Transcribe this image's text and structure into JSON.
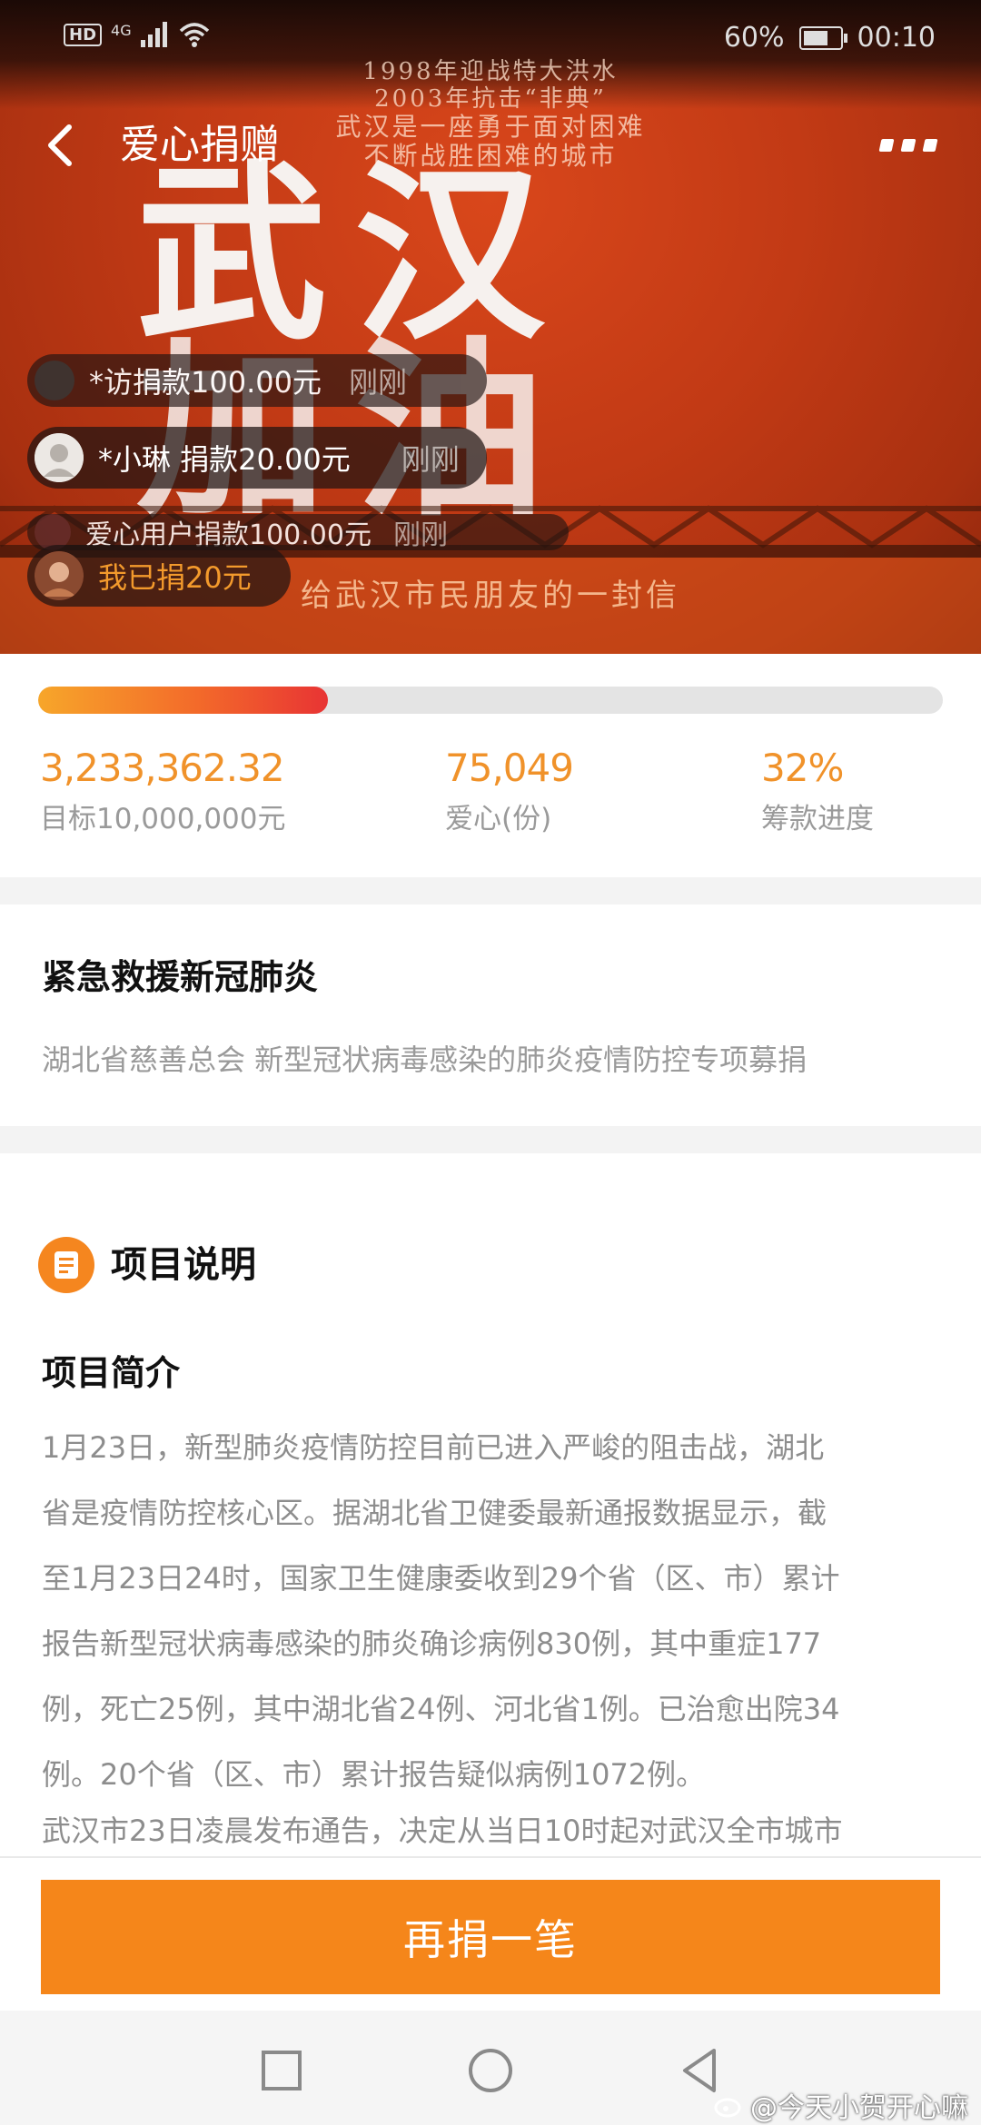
{
  "status_bar": {
    "hd": "HD",
    "network": "4G",
    "battery": "60%",
    "battery_level": 0.6,
    "time": "00:10"
  },
  "app_bar": {
    "title": "爱心捐赠",
    "back_icon": "back-arrow-icon",
    "more_icon": "more-dots-icon"
  },
  "banner": {
    "line1": "1998年迎战特大洪水",
    "line2": "2003年抗击“非典”",
    "line3": "武汉是一座勇于面对困难",
    "line4": "不断战胜困难的城市",
    "big_text_1": "武汉",
    "big_text_2": "加油",
    "bottom_text": "给武汉市民朋友的一封信"
  },
  "donation_ticker": [
    {
      "text": "*访捐款100.00元",
      "time": "刚刚"
    },
    {
      "text": "*小琳 捐款20.00元",
      "time": "刚刚"
    },
    {
      "text": "爱心用户捐款100.00元",
      "time": "刚刚"
    }
  ],
  "my_donation": "我已捐20元",
  "progress": {
    "fraction": 0.32
  },
  "stats": {
    "raised": "3,233,362.32",
    "goal_label": "目标10,000,000元",
    "donors": "75,049",
    "donors_label": "爱心(份)",
    "percent": "32%",
    "percent_label": "筹款进度"
  },
  "project": {
    "title": "紧急救援新冠肺炎",
    "subtitle": "湖北省慈善总会 新型冠状病毒感染的肺炎疫情防控专项募捐"
  },
  "details": {
    "section_title": "项目说明",
    "intro_title": "项目简介",
    "paragraph_lines": [
      "1月23日，新型肺炎疫情防控目前已进入严峻的阻击战，湖北",
      "省是疫情防控核心区。据湖北省卫健委最新通报数据显示，截",
      "至1月23日24时，国家卫生健康委收到29个省（区、市）累计",
      "报告新型冠状病毒感染的肺炎确诊病例830例，其中重症177",
      "例，死亡25例，其中湖北省24例、河北省1例。已治愈出院34",
      "例。20个省（区、市）累计报告疑似病例1072例。",
      "武汉市23日凌晨发布通告，决定从当日10时起对武汉全市城市"
    ]
  },
  "donate_button": "再捐一笔",
  "watermark": "@今天小贺开心嘛"
}
